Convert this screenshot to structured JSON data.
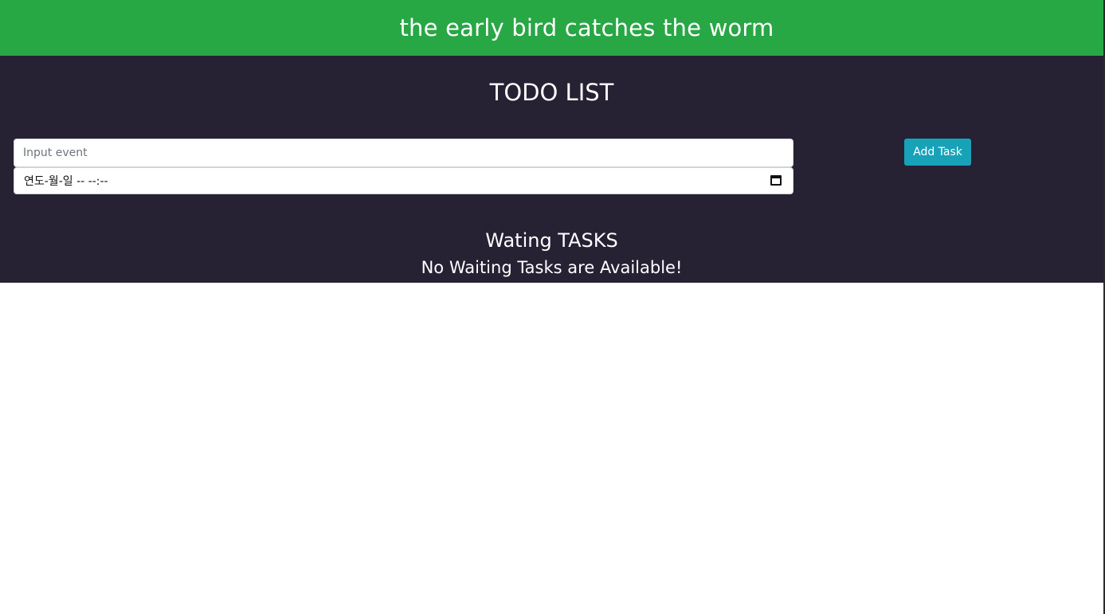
{
  "banner": {
    "text": "the early bird catches the worm"
  },
  "app": {
    "title": "TODO LIST"
  },
  "form": {
    "event_input": {
      "value": "",
      "placeholder": "Input event"
    },
    "datetime_input": {
      "display": "연도-월-일 -- --:--",
      "icon": "calendar-icon"
    },
    "add_button_label": "Add Task"
  },
  "waiting": {
    "title": "Wating TASKS",
    "empty_message": "No Waiting Tasks are Available!"
  },
  "colors": {
    "banner": "#28a745",
    "panel": "#262133",
    "button": "#17a2b8"
  }
}
